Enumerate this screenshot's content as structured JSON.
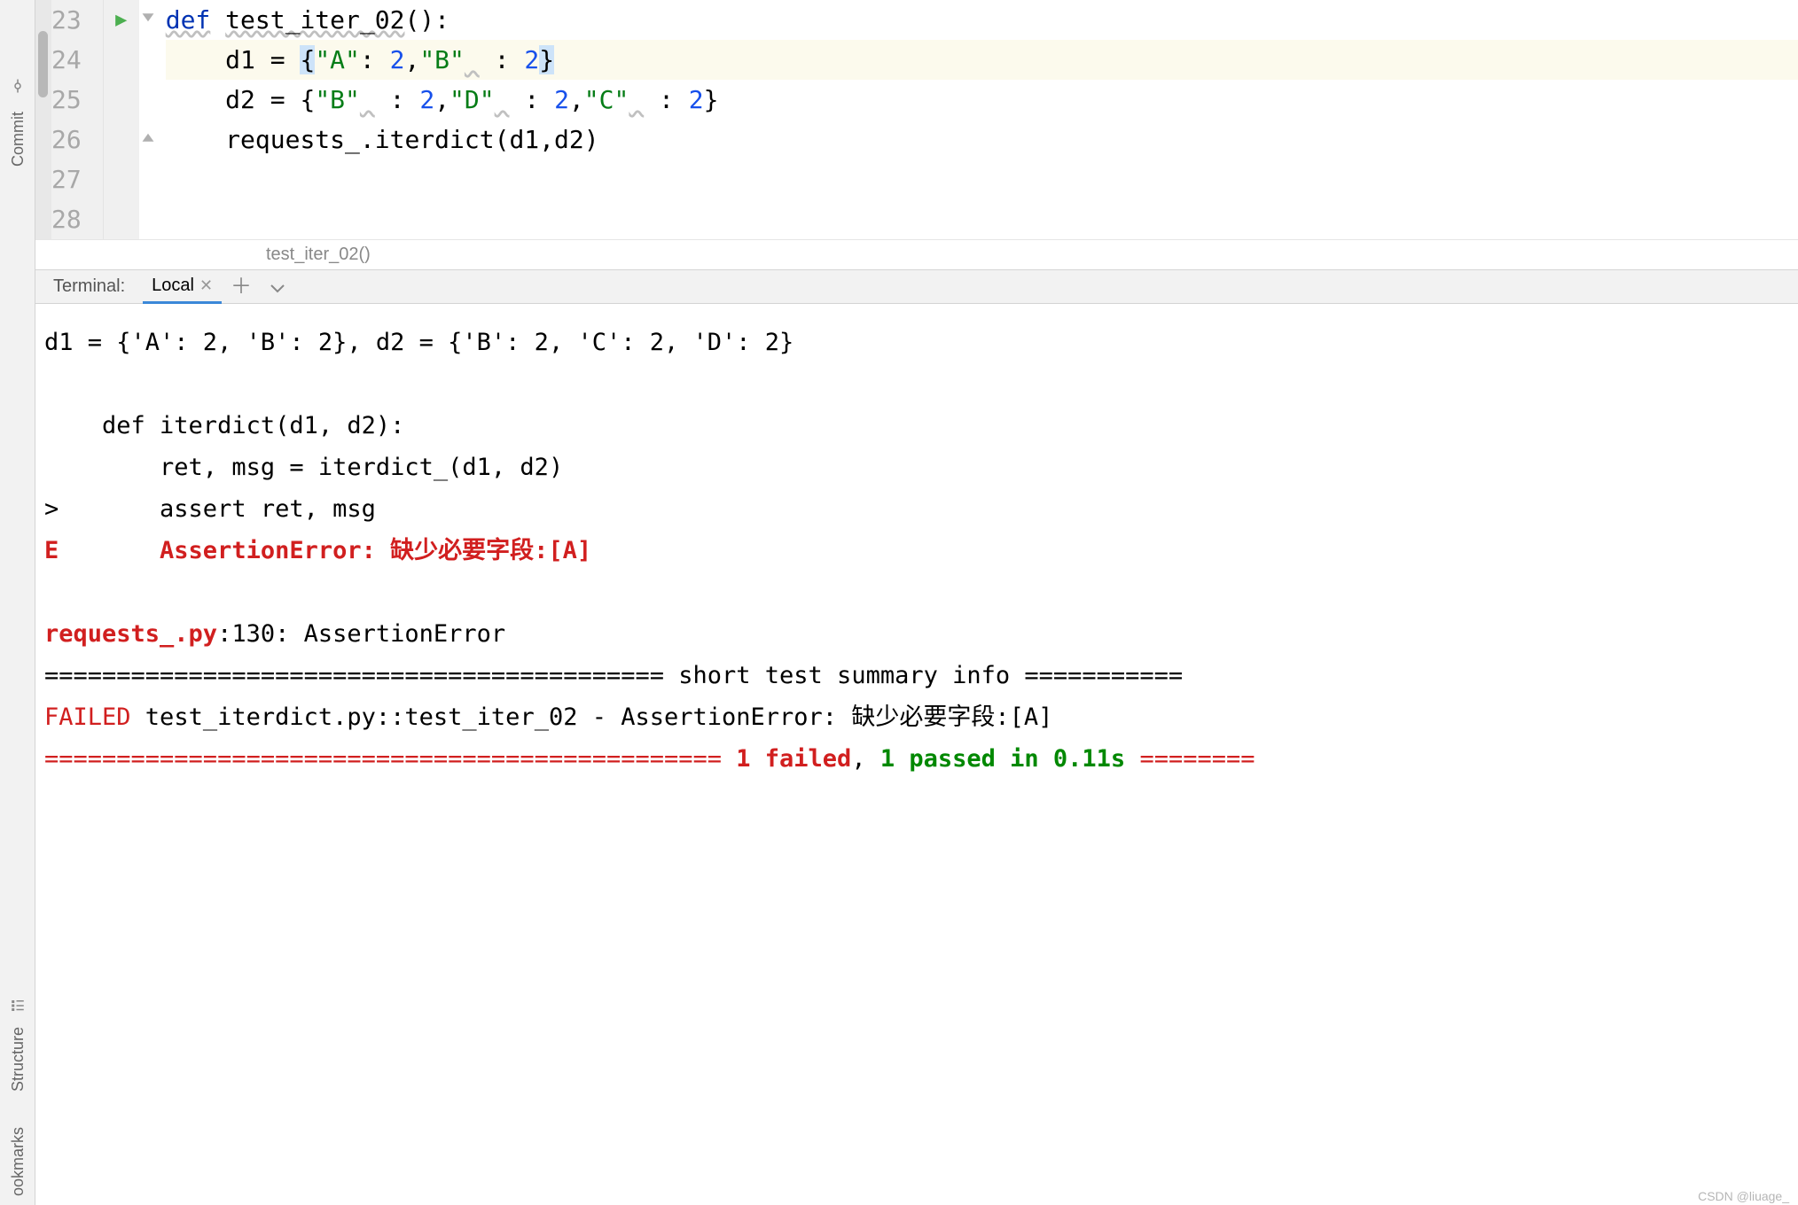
{
  "sidebar": {
    "commit_label": "Commit",
    "structure_label": "Structure",
    "bookmarks_label": "ookmarks"
  },
  "editor": {
    "lines": [
      "23",
      "24",
      "25",
      "26",
      "27",
      "28"
    ],
    "code": {
      "l23_def": "def",
      "l23_fn": "test_iter_02",
      "l23_rest": "():",
      "l24_var": "d1",
      "l24_eq": " = ",
      "l24_lb": "{",
      "l24_k1": "\"A\"",
      "l24_c1": ": ",
      "l24_v1": "2",
      "l24_s1": ",",
      "l24_k2": "\"B\"",
      "l24_sp": " ",
      "l24_c2": " : ",
      "l24_v2": "2",
      "l24_rb": "}",
      "l25_var": "d2",
      "l25_eq": " = ",
      "l25_lb": "{",
      "l25_k1": "\"B\"",
      "l25_sp1": " ",
      "l25_c1": " : ",
      "l25_v1": "2",
      "l25_s1": ",",
      "l25_k2": "\"D\"",
      "l25_sp2": " ",
      "l25_c2": " : ",
      "l25_v2": "2",
      "l25_s2": ",",
      "l25_k3": "\"C\"",
      "l25_sp3": " ",
      "l25_c3": " : ",
      "l25_v3": "2",
      "l25_rb": "}",
      "l26_call": "requests_.iterdict(d1,d2)"
    }
  },
  "breadcrumb": "test_iter_02()",
  "terminal": {
    "title": "Terminal:",
    "tab_label": "Local",
    "output": {
      "l1": "d1 = {'A': 2, 'B': 2}, d2 = {'B': 2, 'C': 2, 'D': 2}",
      "blank": "",
      "l2": "    def iterdict(d1, d2):",
      "l3": "        ret, msg = iterdict_(d1, d2)",
      "l4": ">       assert ret, msg",
      "l5a": "E       AssertionError: ",
      "l5b": "缺少必要字段:[A]",
      "l6a": "requests_.py",
      "l6b": ":130: AssertionError",
      "l7a": "=========================================== ",
      "l7b": "short test summary info",
      "l7c": " ===========",
      "l8a": "FAILED",
      "l8b": " test_iterdict.py::test_iter_02 - AssertionError: 缺少必要字段:[A]",
      "l9a": "=============================================== ",
      "l9fail": "1 failed",
      "l9sep": ", ",
      "l9pass": "1 passed",
      "l9rest": " in 0.11s",
      "l9b": " ========"
    }
  },
  "watermark": "CSDN @liuage_"
}
